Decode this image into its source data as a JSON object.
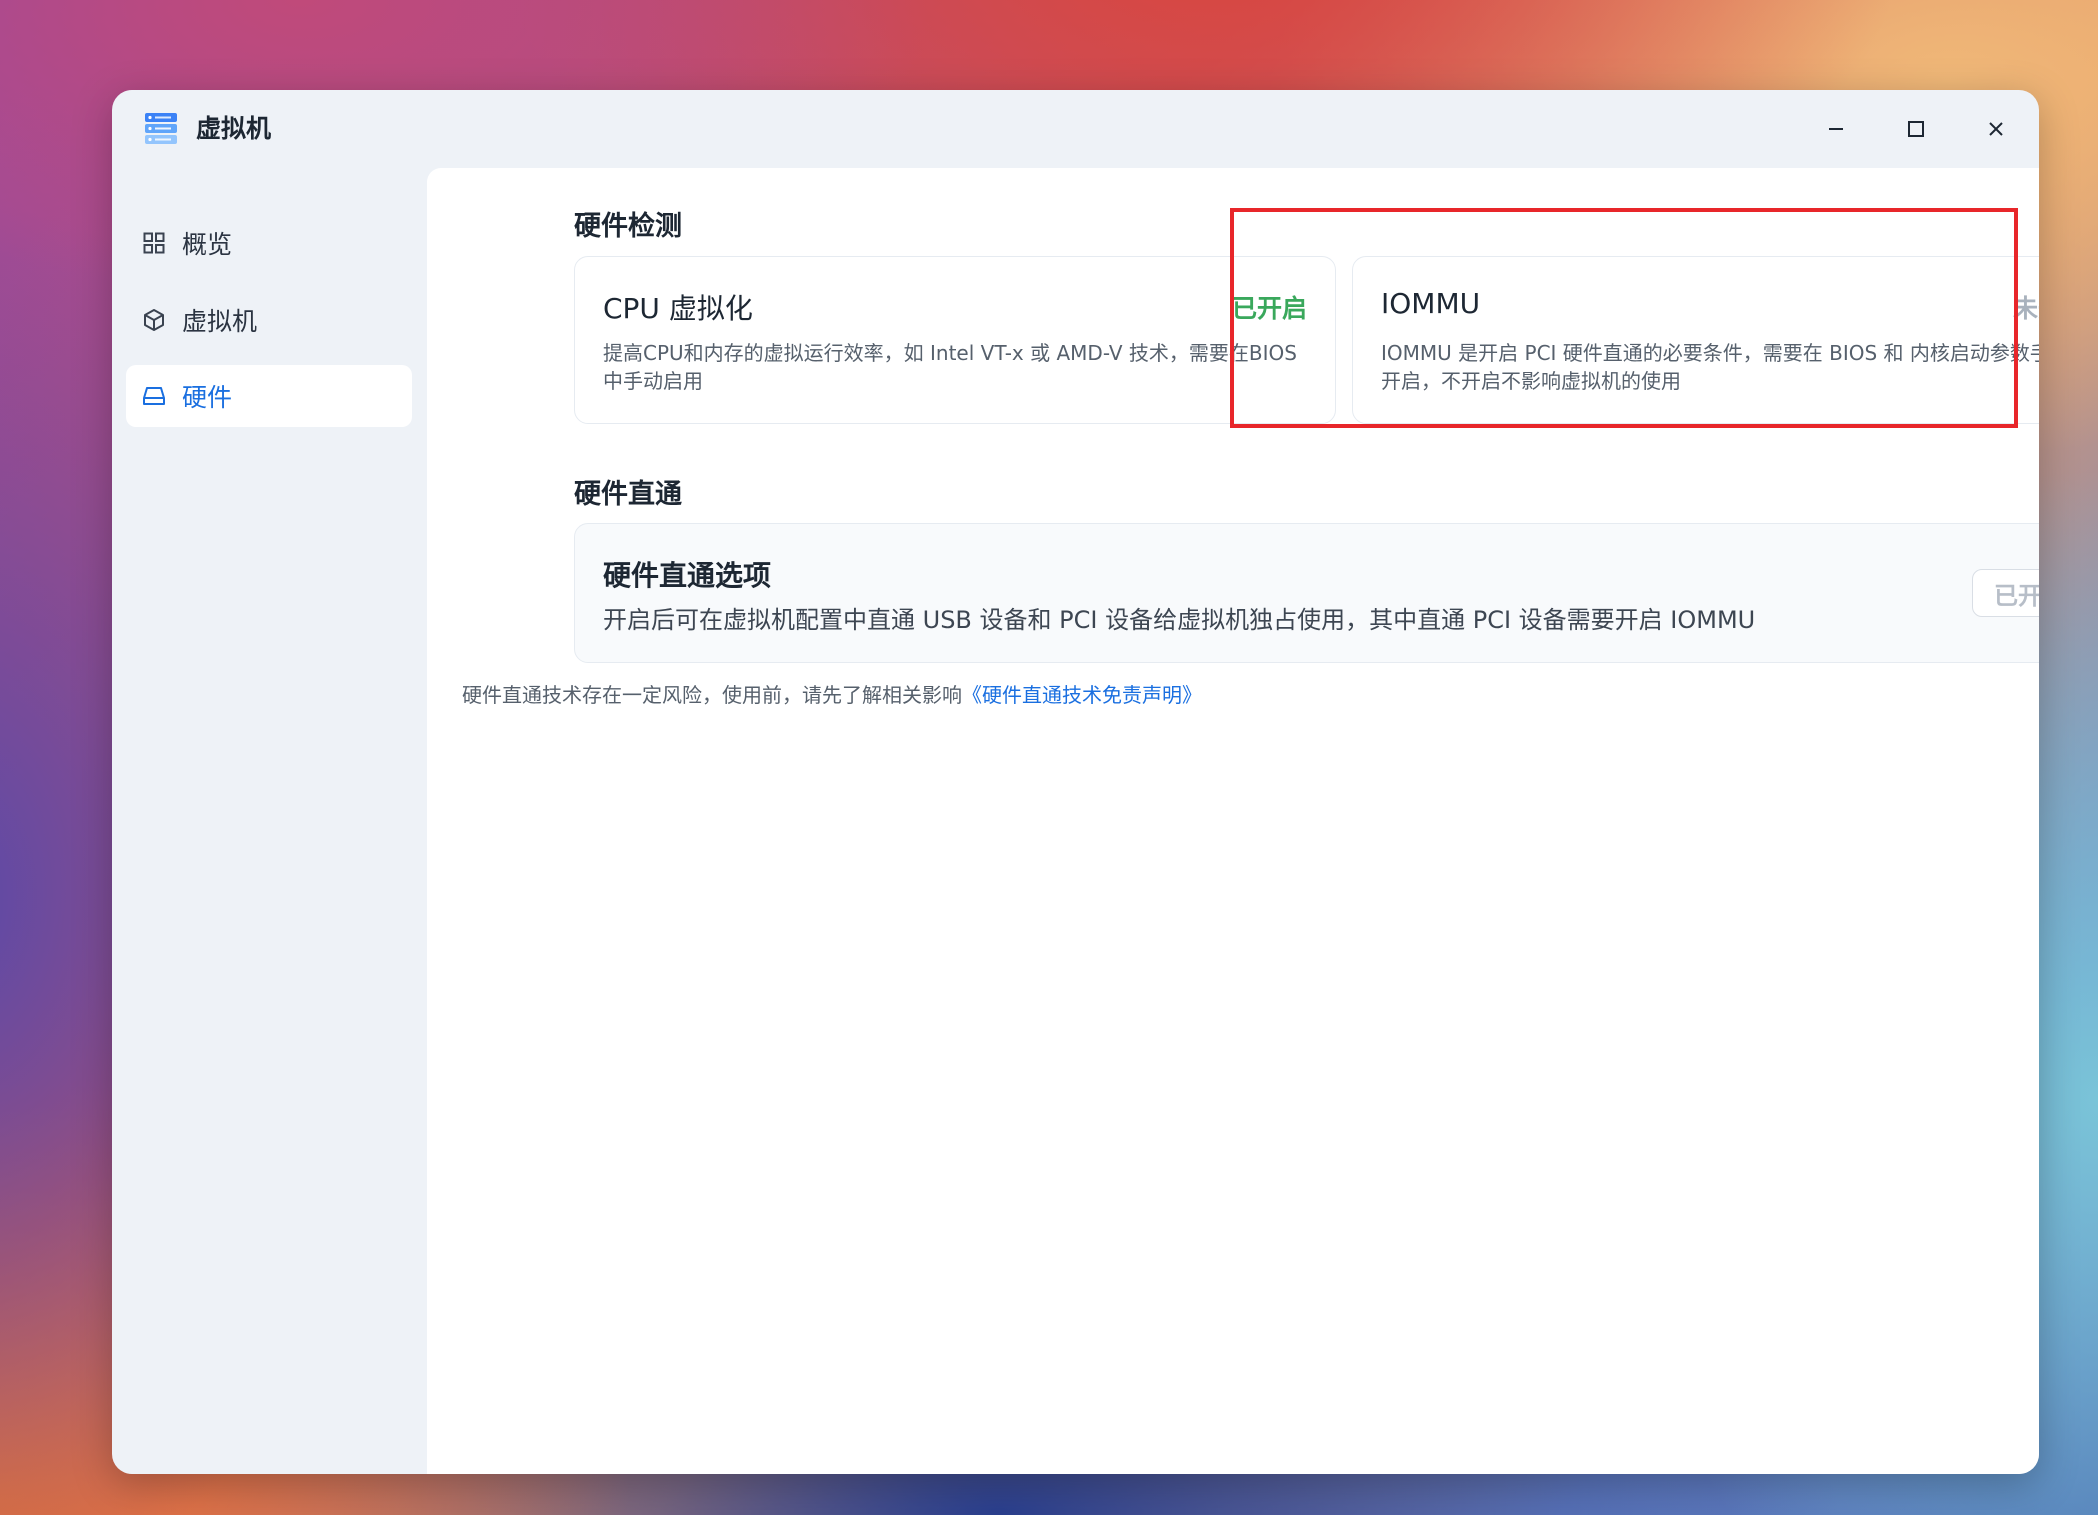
{
  "window": {
    "title": "虚拟机",
    "controls": [
      "minimize-icon",
      "maximize-icon",
      "close-icon"
    ]
  },
  "sidebar": {
    "items": [
      {
        "label": "概览",
        "icon": "grid-icon",
        "active": false
      },
      {
        "label": "虚拟机",
        "icon": "cube-icon",
        "active": false
      },
      {
        "label": "硬件",
        "icon": "drive-icon",
        "active": true
      }
    ]
  },
  "hardware_detection": {
    "title": "硬件检测",
    "cards": [
      {
        "title": "CPU 虚拟化",
        "status": "已开启",
        "status_color": "#3aa85c",
        "description": "提高CPU和内存的虚拟运行效率，如 Intel VT-x 或 AMD-V 技术，需要在BIOS中手动启用"
      },
      {
        "title": "IOMMU",
        "status": "未开启",
        "status_color": "#a9b2bd",
        "description": "IOMMU 是开启 PCI 硬件直通的必要条件，需要在 BIOS 和 内核启动参数手动开启，不开启不影响虚拟机的使用"
      }
    ]
  },
  "passthrough": {
    "title": "硬件直通",
    "option_title": "硬件直通选项",
    "option_description": "开启后可在虚拟机配置中直通 USB 设备和 PCI 设备给虚拟机独占使用，其中直通 PCI 设备需要开启 IOMMU",
    "button_label": "已开启",
    "note": "硬件直通技术存在一定风险，使用前，请先了解相关影响",
    "note_link": "《硬件直通技术免责声明》"
  },
  "colors": {
    "accent": "#1a6fe0",
    "highlight_border": "#e8262a"
  }
}
